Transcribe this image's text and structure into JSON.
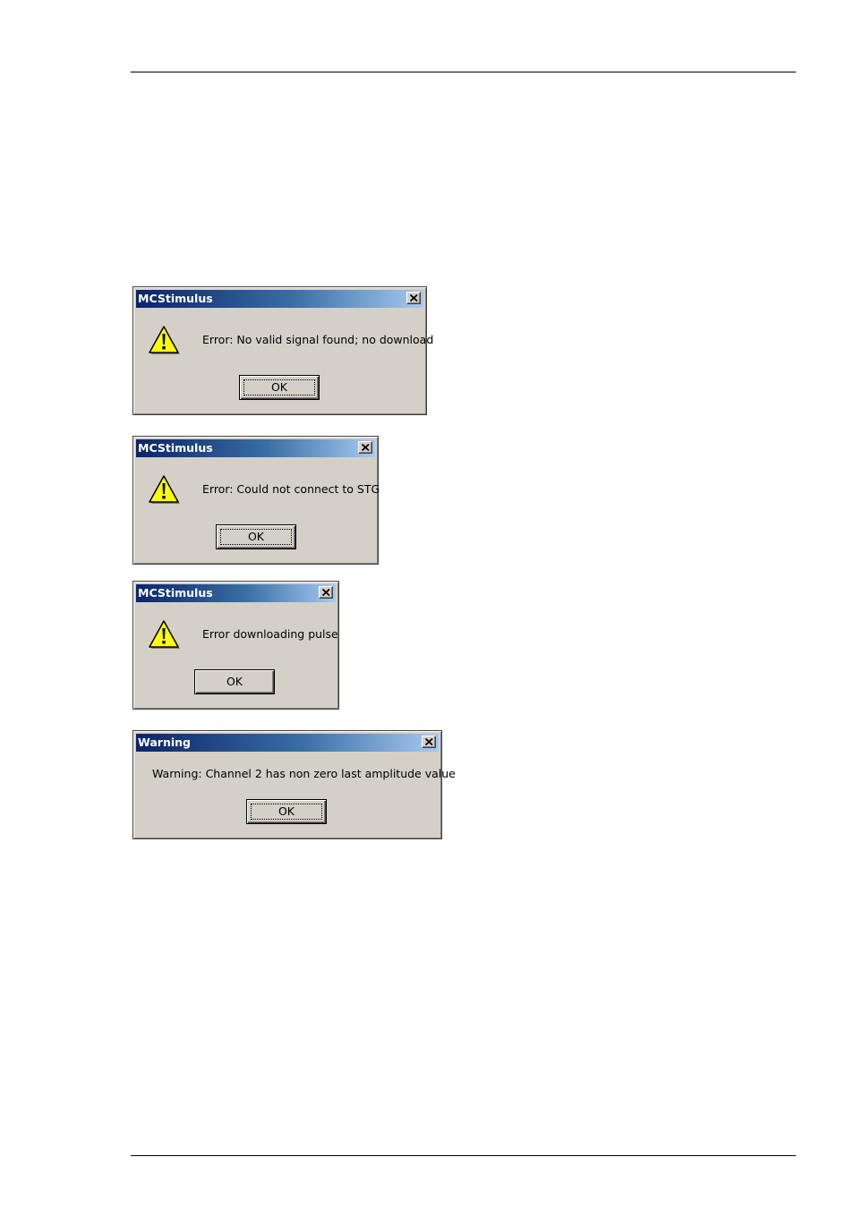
{
  "dialogs": [
    {
      "title": "MCStimulus",
      "message": "Error: No valid signal found; no download",
      "ok_label": "OK",
      "icon": "warning-icon",
      "close_icon": "close-icon"
    },
    {
      "title": "MCStimulus",
      "message": "Error: Could not connect to STG",
      "ok_label": "OK",
      "icon": "warning-icon",
      "close_icon": "close-icon"
    },
    {
      "title": "MCStimulus",
      "message": "Error downloading pulse",
      "ok_label": "OK",
      "icon": "warning-icon",
      "close_icon": "close-icon"
    },
    {
      "title": "Warning",
      "message": "Warning: Channel 2 has non zero last amplitude value",
      "ok_label": "OK",
      "close_icon": "close-icon"
    }
  ],
  "colors": {
    "titlebar_start": "#0a246a",
    "titlebar_end": "#a6caf0",
    "dialog_face": "#d4d0c8",
    "warning_yellow": "#ffff00"
  }
}
